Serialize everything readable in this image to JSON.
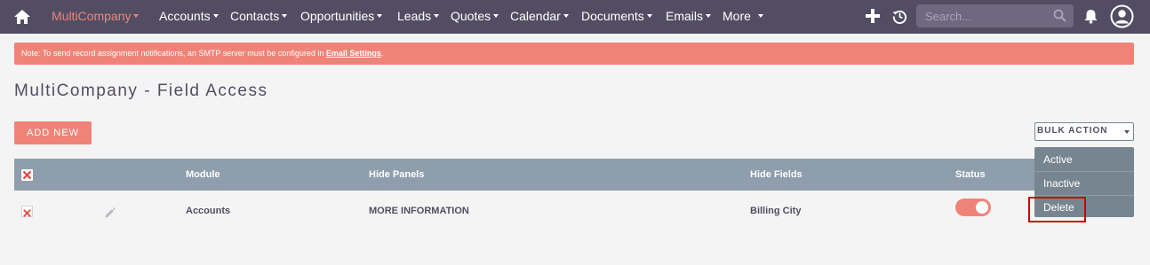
{
  "nav": {
    "items": [
      {
        "label": "MultiCompany",
        "active": true
      },
      {
        "label": "Accounts"
      },
      {
        "label": "Contacts"
      },
      {
        "label": "Opportunities"
      },
      {
        "label": "Leads"
      },
      {
        "label": "Quotes"
      },
      {
        "label": "Calendar"
      },
      {
        "label": "Documents"
      },
      {
        "label": "Emails"
      },
      {
        "label": "More"
      }
    ],
    "search_placeholder": "Search..."
  },
  "notice": {
    "text": "Note: To send record assignment notifications, an SMTP server must be configured in ",
    "link": "Email Settings",
    "suffix": "."
  },
  "page": {
    "title": "MultiCompany - Field Access"
  },
  "actions": {
    "add_new": "ADD NEW",
    "bulk_action": "BULK ACTION"
  },
  "table": {
    "columns": [
      "Module",
      "Hide Panels",
      "Hide Fields",
      "Status"
    ],
    "rows": [
      {
        "module": "Accounts",
        "hide_panels": "MORE INFORMATION",
        "hide_fields": "Billing City",
        "status_on": true
      }
    ]
  },
  "bulk_menu": {
    "items": [
      "Active",
      "Inactive",
      "Delete"
    ]
  },
  "colors": {
    "nav_bg": "#534d64",
    "accent": "#f08377",
    "table_header": "#8e9eac",
    "menu_bg": "#778591",
    "highlight_border": "#cc0000"
  }
}
